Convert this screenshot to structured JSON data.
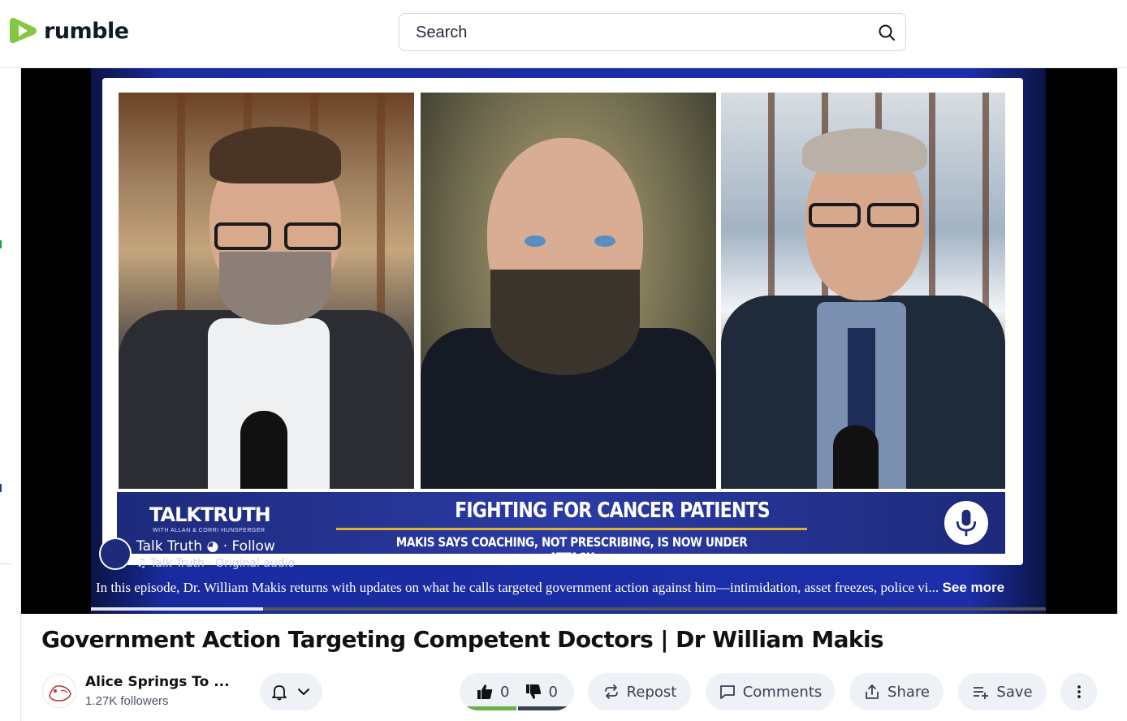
{
  "header": {
    "logo_text": "rumble",
    "search_placeholder": "Search",
    "brand_color": "#85c742"
  },
  "video": {
    "lower_third": {
      "brand": "TALKTRUTH",
      "brand_sub": "WITH ALLAN & CORRI HUNSPERGER",
      "headline": "FIGHTING FOR CANCER PATIENTS",
      "subline": "MAKIS SAYS COACHING, NOT PRESCRIBING, IS NOW UNDER ATTACK"
    },
    "overlay_channel_name": "Talk Truth ◕ · Follow",
    "overlay_audio": "♫ Talk Truth · Original audio",
    "caption": "In this episode, Dr. William Makis returns with updates on what he calls targeted government action against him—intimidation, asset freezes, police vi...",
    "see_more": "See more",
    "progress_fraction": 0.18
  },
  "title": "Government Action Targeting Competent Doctors | Dr William Makis",
  "channel": {
    "name": "Alice Springs To ...",
    "followers": "1.27K followers"
  },
  "actions": {
    "likes": "0",
    "dislikes": "0",
    "repost": "Repost",
    "comments": "Comments",
    "share": "Share",
    "save": "Save"
  },
  "icons": [
    "search-icon",
    "bell-icon",
    "chevron-down-icon",
    "thumbs-up-icon",
    "thumbs-down-icon",
    "repost-icon",
    "comment-icon",
    "share-icon",
    "playlist-add-icon",
    "more-vertical-icon"
  ]
}
